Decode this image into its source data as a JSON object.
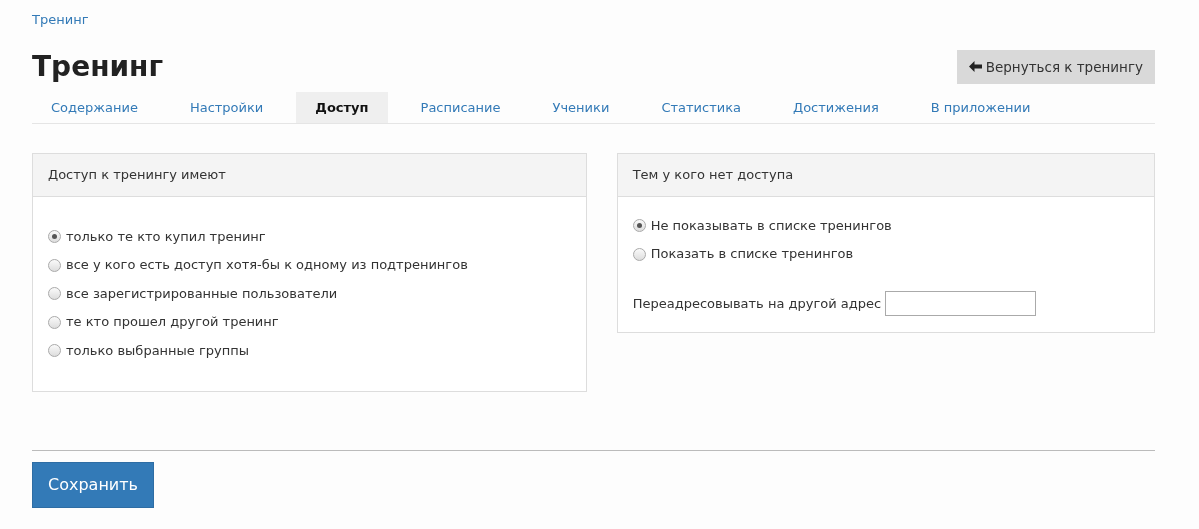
{
  "breadcrumb": "Тренинг",
  "title": "Тренинг",
  "back_button": {
    "label": "Вернуться к тренингу"
  },
  "tabs": [
    {
      "label": "Содержание",
      "selected": false
    },
    {
      "label": "Настройки",
      "selected": false
    },
    {
      "label": "Доступ",
      "selected": true
    },
    {
      "label": "Расписание",
      "selected": false
    },
    {
      "label": "Ученики",
      "selected": false
    },
    {
      "label": "Статистика",
      "selected": false
    },
    {
      "label": "Достижения",
      "selected": false
    },
    {
      "label": "В приложении",
      "selected": false
    }
  ],
  "access_panel": {
    "title": "Доступ к тренингу имеют",
    "options": [
      {
        "label": "только те кто купил тренинг",
        "selected": true
      },
      {
        "label": "все у кого есть доступ хотя-бы к одному из подтренингов",
        "selected": false
      },
      {
        "label": "все зарегистрированные пользователи",
        "selected": false
      },
      {
        "label": "те кто прошел другой тренинг",
        "selected": false
      },
      {
        "label": "только выбранные группы",
        "selected": false
      }
    ]
  },
  "no_access_panel": {
    "title": "Тем у кого нет доступа",
    "options": [
      {
        "label": "Не показывать в списке тренингов",
        "selected": true
      },
      {
        "label": "Показать в списке тренингов",
        "selected": false
      }
    ],
    "redirect_label": "Переадресовывать на другой адрес"
  },
  "save_button": {
    "label": "Сохранить"
  }
}
